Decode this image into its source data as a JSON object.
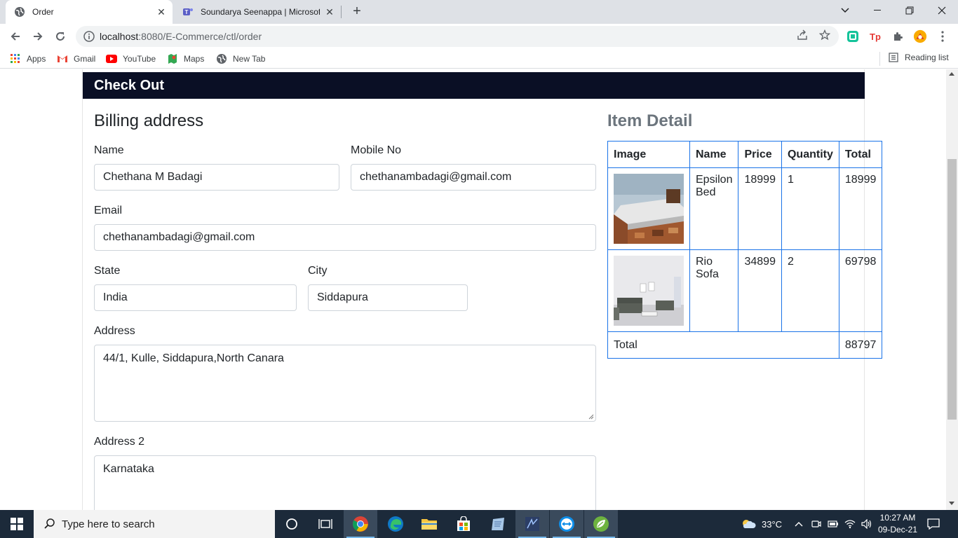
{
  "browser": {
    "tabs": [
      {
        "title": "Order",
        "active": true
      },
      {
        "title": "Soundarya Seenappa | Microsoft",
        "active": false
      }
    ],
    "url_host": "localhost",
    "url_rest": ":8080/E-Commerce/ctl/order",
    "bookmarks": [
      "Apps",
      "Gmail",
      "YouTube",
      "Maps",
      "New Tab"
    ],
    "reading_list": "Reading list"
  },
  "page": {
    "header": "Check Out",
    "billing_title": "Billing address",
    "form": {
      "name_label": "Name",
      "name_value": "Chethana M Badagi",
      "mobile_label": "Mobile No",
      "mobile_value": "chethanambadagi@gmail.com",
      "email_label": "Email",
      "email_value": "chethanambadagi@gmail.com",
      "state_label": "State",
      "state_value": "India",
      "city_label": "City",
      "city_value": "Siddapura",
      "address_label": "Address",
      "address_value": "44/1, Kulle, Siddapura,North Canara",
      "address2_label": "Address 2",
      "address2_value": "Karnataka"
    },
    "item_detail": {
      "title": "Item Detail",
      "headers": [
        "Image",
        "Name",
        "Price",
        "Quantity",
        "Total"
      ],
      "rows": [
        {
          "name_line1": "Epsilon",
          "name_line2": "Bed",
          "price": "18999",
          "quantity": "1",
          "total": "18999"
        },
        {
          "name_line1": "Rio",
          "name_line2": "Sofa",
          "price": "34899",
          "quantity": "2",
          "total": "69798"
        }
      ],
      "total_label": "Total",
      "total_value": "88797"
    }
  },
  "taskbar": {
    "search_placeholder": "Type here to search",
    "temperature": "33°C",
    "time": "10:27 AM",
    "date": "09-Dec-21"
  }
}
